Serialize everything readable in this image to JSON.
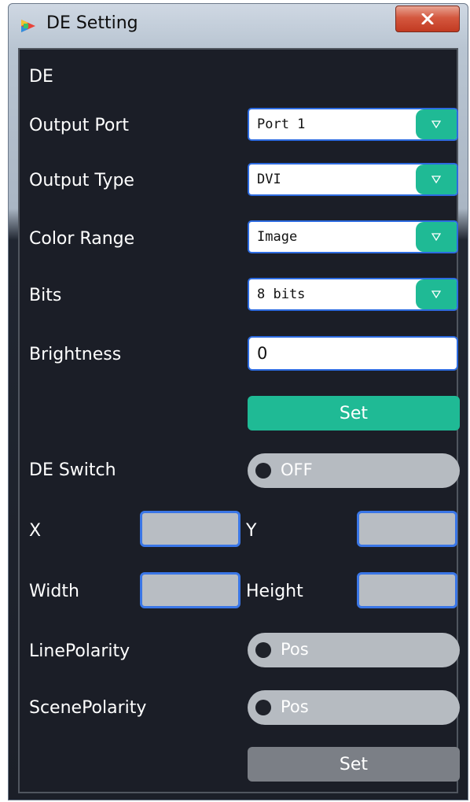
{
  "window": {
    "title": "DE Setting",
    "icons": {
      "app": "app-logo-icon",
      "close": "close-icon"
    },
    "colors": {
      "accent": "#1fba95",
      "panel": "#1b1e27",
      "close": "#c23a22"
    }
  },
  "section": {
    "title": "DE"
  },
  "fields": {
    "output_port": {
      "label": "Output Port",
      "value": "Port 1"
    },
    "output_type": {
      "label": "Output Type",
      "value": "DVI"
    },
    "color_range": {
      "label": "Color Range",
      "value": "Image"
    },
    "bits": {
      "label": "Bits",
      "value": "8 bits"
    },
    "brightness": {
      "label": "Brightness",
      "value": "0"
    }
  },
  "set_button_1": {
    "label": "Set"
  },
  "de_switch": {
    "label": "DE Switch",
    "state": "OFF"
  },
  "x": {
    "label": "X",
    "value": ""
  },
  "y": {
    "label": "Y",
    "value": ""
  },
  "width": {
    "label": "Width",
    "value": ""
  },
  "height": {
    "label": "Height",
    "value": ""
  },
  "line_polarity": {
    "label": "LinePolarity",
    "state": "Pos"
  },
  "scene_polarity": {
    "label": "ScenePolarity",
    "state": "Pos"
  },
  "set_button_2": {
    "label": "Set"
  }
}
